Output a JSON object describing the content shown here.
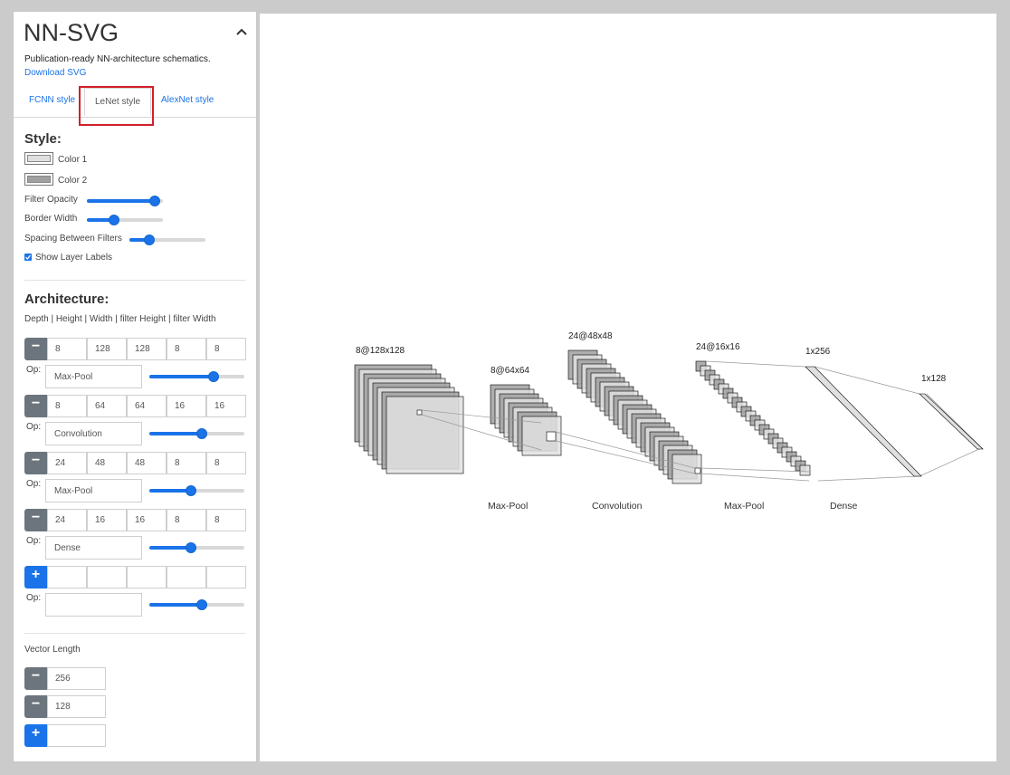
{
  "app": {
    "title": "NN-SVG",
    "subtitle": "Publication-ready NN-architecture schematics.",
    "download_link": "Download SVG"
  },
  "tabs": [
    {
      "label": "FCNN style",
      "active": false
    },
    {
      "label": "LeNet style",
      "active": true
    },
    {
      "label": "AlexNet style",
      "active": false
    }
  ],
  "style_section": {
    "heading": "Style:",
    "color1": {
      "label": "Color 1",
      "value": "#e0e0e0"
    },
    "color2": {
      "label": "Color 2",
      "value": "#a0a0a0"
    },
    "filter_opacity": {
      "label": "Filter Opacity",
      "value": 0.88
    },
    "border_width": {
      "label": "Border Width",
      "value": 0.35
    },
    "spacing": {
      "label": "Spacing Between Filters",
      "value": 0.25
    },
    "show_labels": {
      "label": "Show Layer Labels",
      "checked": true
    }
  },
  "architecture": {
    "heading": "Architecture:",
    "columns_caption": "Depth | Height | Width | filter Height | filter Width",
    "op_label": "Op:",
    "layers": [
      {
        "values": [
          "8",
          "128",
          "128",
          "8",
          "8"
        ],
        "op": "Max-Pool",
        "slider": 0.67
      },
      {
        "values": [
          "8",
          "64",
          "64",
          "16",
          "16"
        ],
        "op": "Convolution",
        "slider": 0.54
      },
      {
        "values": [
          "24",
          "48",
          "48",
          "8",
          "8"
        ],
        "op": "Max-Pool",
        "slider": 0.43
      },
      {
        "values": [
          "24",
          "16",
          "16",
          "8",
          "8"
        ],
        "op": "Dense",
        "slider": 0.43
      }
    ],
    "new_layer": {
      "values": [
        "",
        "",
        "",
        "",
        ""
      ],
      "op": "",
      "slider": 0.54
    }
  },
  "vector_section": {
    "label": "Vector Length",
    "vectors": [
      "256",
      "128"
    ],
    "new_vector": ""
  },
  "diagram": {
    "layer_labels": [
      "8@128x128",
      "8@64x64",
      "24@48x48",
      "24@16x16",
      "1x256",
      "1x128"
    ],
    "op_labels": [
      "Max-Pool",
      "Convolution",
      "Max-Pool",
      "Dense"
    ],
    "fill_color": "#e0e0e0",
    "dark_fill_color": "#a0a0a0",
    "stroke_color": "#000000"
  }
}
